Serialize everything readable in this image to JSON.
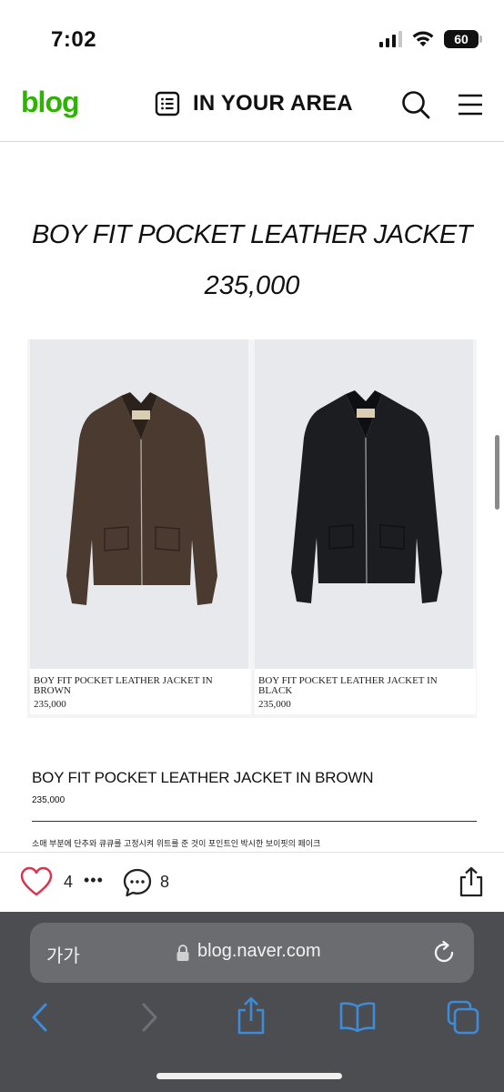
{
  "status_bar": {
    "time": "7:02",
    "battery": "60"
  },
  "header": {
    "logo": "blog",
    "title": "IN YOUR AREA"
  },
  "post": {
    "title": "BOY FIT POCKET LEATHER JACKET",
    "price": "235,000"
  },
  "products": [
    {
      "name": "BOY FIT POCKET LEATHER JACKET IN BROWN",
      "price": "235,000",
      "color": "#4a3a30"
    },
    {
      "name": "BOY FIT POCKET LEATHER JACKET IN BLACK",
      "price": "235,000",
      "color": "#1c1d21"
    }
  ],
  "detail": {
    "name": "BOY FIT POCKET LEATHER JACKET IN BROWN",
    "price": "235,000",
    "description": "소매 부분에 단추와 큐큐를 고정시켜 위트를 준 것이 포인트인 박시한 보이핏의 페이크"
  },
  "actions": {
    "likes": "4",
    "more": "•••",
    "comments": "8"
  },
  "browser": {
    "text_size_button": "가가",
    "url": "blog.naver.com"
  },
  "colors": {
    "brand_green": "#2db400",
    "like_red": "#e0314b",
    "ios_blue": "#3d8bd9"
  }
}
